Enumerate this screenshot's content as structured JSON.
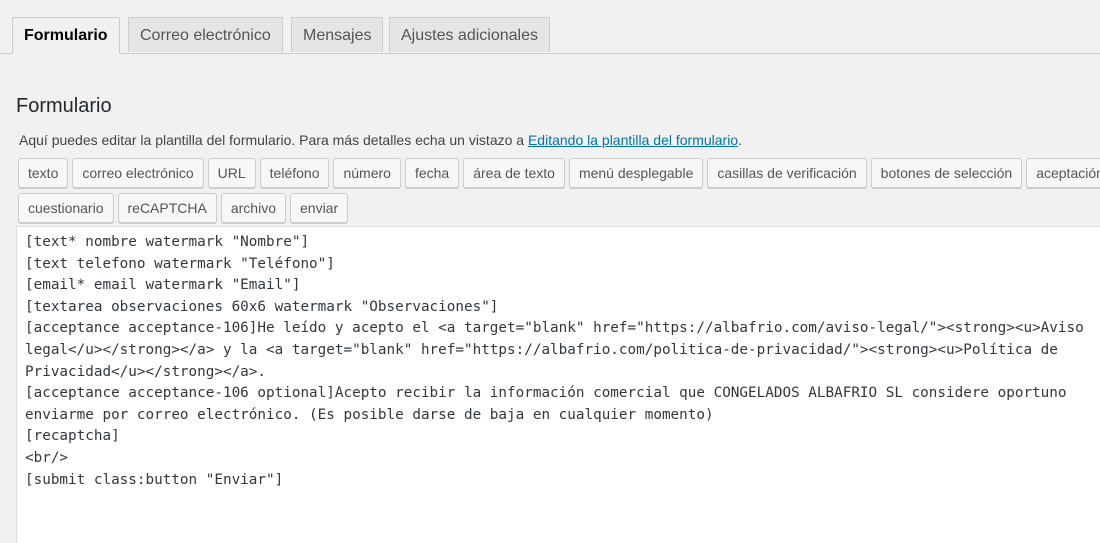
{
  "tabs": [
    {
      "label": "Formulario",
      "active": true
    },
    {
      "label": "Correo electrónico",
      "active": false
    },
    {
      "label": "Mensajes",
      "active": false
    },
    {
      "label": "Ajustes adicionales",
      "active": false
    }
  ],
  "section": {
    "title": "Formulario",
    "description_prefix": "Aquí puedes editar la plantilla del formulario. Para más detalles echa un vistazo a ",
    "description_link": "Editando la plantilla del formulario",
    "description_suffix": "."
  },
  "tag_buttons_row1": [
    "texto",
    "correo electrónico",
    "URL",
    "teléfono",
    "número",
    "fecha",
    "área de texto",
    "menú desplegable",
    "casillas de verificación",
    "botones de selección",
    "aceptación"
  ],
  "tag_buttons_row2": [
    "cuestionario",
    "reCAPTCHA",
    "archivo",
    "enviar"
  ],
  "editor": {
    "lines": [
      "[text* nombre watermark \"Nombre\"]",
      "[text telefono watermark \"Teléfono\"]",
      "[email* email watermark \"Email\"]",
      "[textarea observaciones 60x6 watermark \"Observaciones\"]",
      "[acceptance acceptance-106]He leído y acepto el <a target=\"blank\" href=\"https://albafrio.com/aviso-legal/\"><strong><u>Aviso",
      "legal</u></strong></a> y la <a target=\"blank\" href=\"https://albafrio.com/politica-de-privacidad/\"><strong><u>Política de",
      "Privacidad</u></strong></a>.",
      "[acceptance acceptance-106 optional]Acepto recibir la información comercial que CONGELADOS ALBAFRIO SL considere oportuno",
      "enviarme por correo electrónico. (Es posible darse de baja en cualquier momento)",
      "[recaptcha]",
      "<br/>",
      "[submit class:button \"Enviar\"]"
    ]
  }
}
